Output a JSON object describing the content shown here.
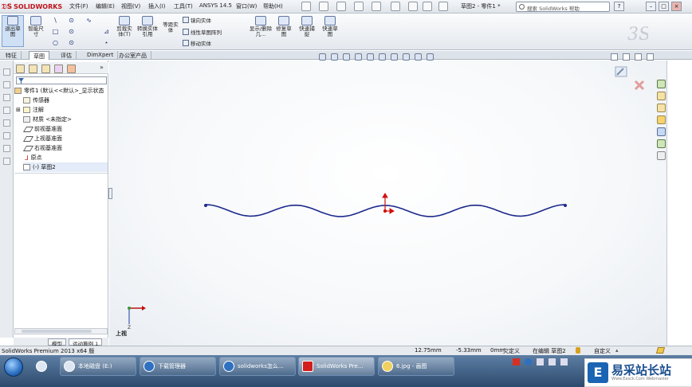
{
  "app": {
    "name": "SOLIDWORKS",
    "menu": [
      "文件(F)",
      "编辑(E)",
      "视图(V)",
      "插入(I)",
      "工具(T)",
      "ANSYS 14.5",
      "窗口(W)",
      "帮助(H)"
    ],
    "doc_title": "草图2 - 零件1 *",
    "help_search": "搜索 SolidWorks 帮助",
    "help_icon": "?",
    "win_min": "–",
    "win_max": "□",
    "win_close": "×"
  },
  "ribbon": {
    "big": [
      "退出草图",
      "智能尺寸",
      "剪裁实体(T)",
      "转换实体引用",
      "等距实体",
      "显示/删除几...",
      "修复草图",
      "快速捕捉",
      "快速草图"
    ],
    "small": [
      "镜向实体",
      "线性草图阵列",
      "移动实体"
    ],
    "sketch_tools": [
      "\\",
      "⊙",
      "∿",
      "□",
      "⊙",
      "⊿",
      "○",
      "⊙",
      "⋆"
    ]
  },
  "tabs": [
    "特征",
    "草图",
    "评估",
    "DimXpert",
    "办公室产品"
  ],
  "tree": {
    "root": "零件1 (默认<<默认>_显示状态",
    "items": [
      "传感器",
      "注解",
      "材质 <未指定>",
      "前视基准面",
      "上视基准面",
      "右视基准面",
      "原点",
      "(-) 草图2"
    ]
  },
  "bottom_tabs": [
    "模型",
    "运动算例 1"
  ],
  "view_label": "上视",
  "status": {
    "product": "SolidWorks Premium 2013 x64 版",
    "x": "12.75mm",
    "y": "-5.33mm",
    "z": "0mm",
    "state": "欠定义",
    "editing": "在编辑 草图2",
    "custom": "自定义"
  },
  "taskbar": {
    "buttons": [
      "本地磁盘 (E:)",
      "下载管理器",
      "solidworks怎么...",
      "SolidWorks Pre...",
      "6.jpg - 画图"
    ]
  },
  "watermark": {
    "title": "易采站长站",
    "sub": "Www.Easck.Com Webmaster"
  },
  "colors": {
    "spline": "#1c2a8c",
    "origin_red": "#d01010",
    "accent": "#c0141a"
  }
}
